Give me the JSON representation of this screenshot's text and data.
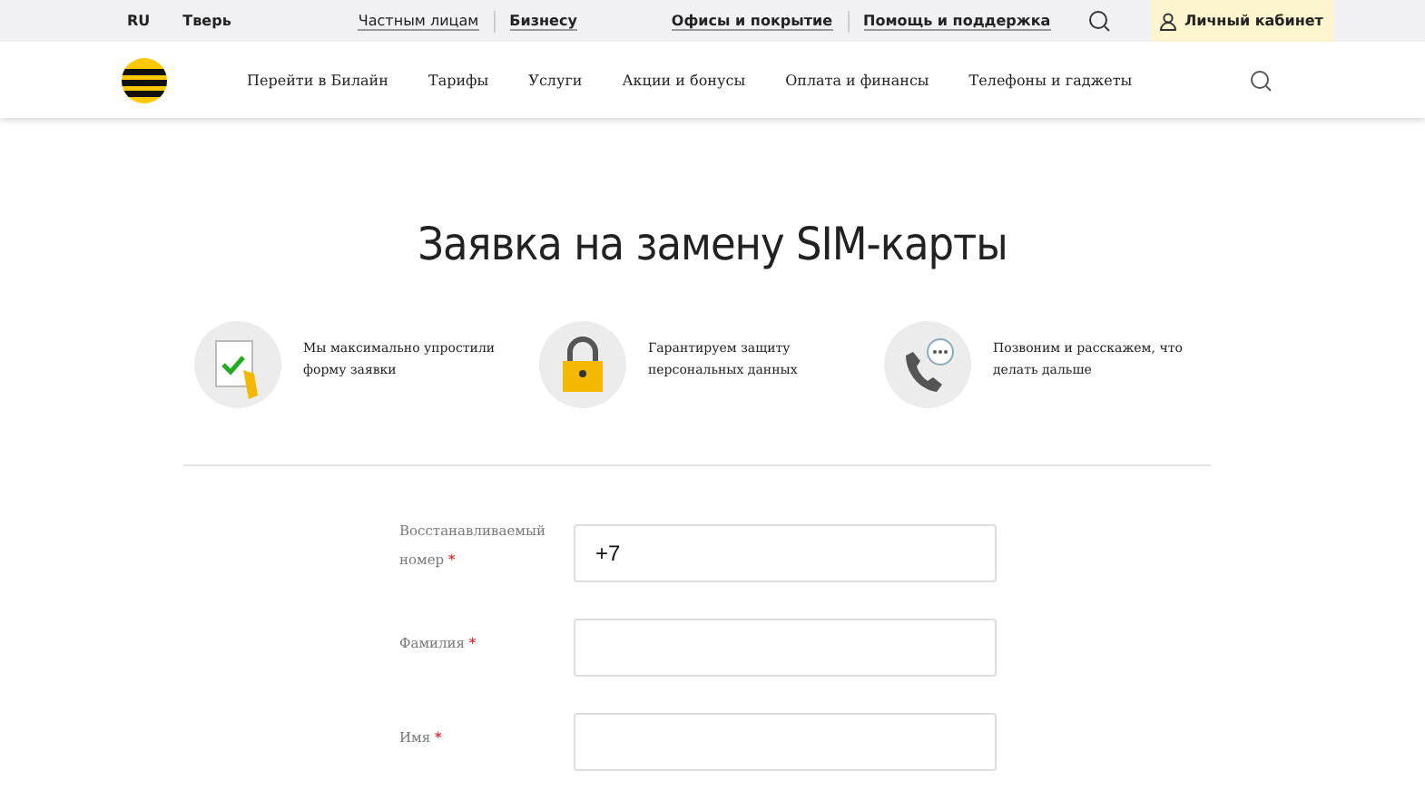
{
  "top_bar": {
    "language": {
      "label": "RU",
      "selected": true
    },
    "city": "Тверь",
    "segments": [
      {
        "label": "Частным лицам",
        "selected": true
      },
      {
        "label": "Бизнесу",
        "selected": false
      }
    ],
    "links": [
      "Офисы и покрытие",
      "Помощь и поддержка"
    ],
    "account": "Личный кабинет"
  },
  "main_nav": {
    "items": [
      "Перейти в Билайн",
      "Тарифы",
      "Услуги",
      "Акции и бонусы",
      "Оплата и финансы",
      "Телефоны и гаджеты"
    ]
  },
  "title": "Заявка на замену SIM-карты",
  "features": [
    {
      "kind": "form",
      "text": "Мы максимально упростили форму заявки"
    },
    {
      "kind": "lock",
      "text": "Гарантируем защиту персональных данных"
    },
    {
      "kind": "phone",
      "text": "Позвоним и расскажем, что делать дальше"
    }
  ],
  "form": {
    "fields": [
      {
        "label": "Восстанавливаемый номер",
        "required_mark": "*",
        "value": "+7"
      },
      {
        "label": "Фамилия",
        "required_mark": "*"
      },
      {
        "label": "Имя",
        "required_mark": "*"
      }
    ]
  }
}
